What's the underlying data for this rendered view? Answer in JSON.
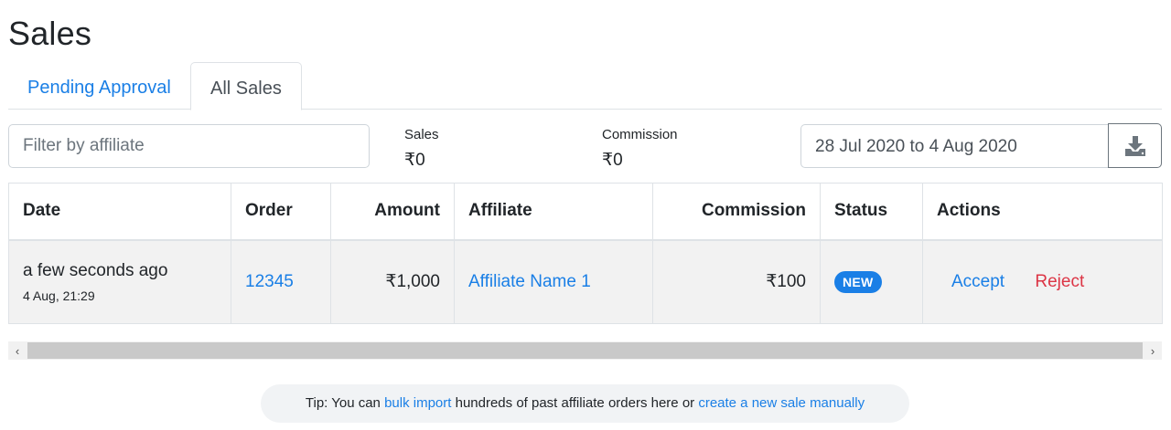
{
  "page": {
    "title": "Sales"
  },
  "tabs": [
    {
      "label": "Pending Approval",
      "active": false
    },
    {
      "label": "All Sales",
      "active": true
    }
  ],
  "filter": {
    "placeholder": "Filter by affiliate",
    "value": ""
  },
  "stats": {
    "sales": {
      "label": "Sales",
      "value": "₹0"
    },
    "commission": {
      "label": "Commission",
      "value": "₹0"
    }
  },
  "date_range": {
    "value": "28 Jul 2020 to 4 Aug 2020"
  },
  "download": {
    "icon": "download-icon"
  },
  "table": {
    "headers": [
      "Date",
      "Order",
      "Amount",
      "Affiliate",
      "Commission",
      "Status",
      "Actions"
    ],
    "rows": [
      {
        "date_relative": "a few seconds ago",
        "date_exact": "4 Aug, 21:29",
        "order": "12345",
        "amount": "₹1,000",
        "affiliate": "Affiliate Name 1",
        "commission": "₹100",
        "status": "NEW",
        "actions": {
          "accept": "Accept",
          "reject": "Reject"
        }
      }
    ]
  },
  "scrollbar": {
    "left_arrow": "‹",
    "right_arrow": "›"
  },
  "tip": {
    "prefix": "Tip: You can ",
    "link1": "bulk import",
    "middle": " hundreds of past affiliate orders here or ",
    "link2": "create a new sale manually"
  },
  "colors": {
    "link": "#1a7fe6",
    "danger": "#dc3545",
    "badge": "#1a7fe6"
  }
}
